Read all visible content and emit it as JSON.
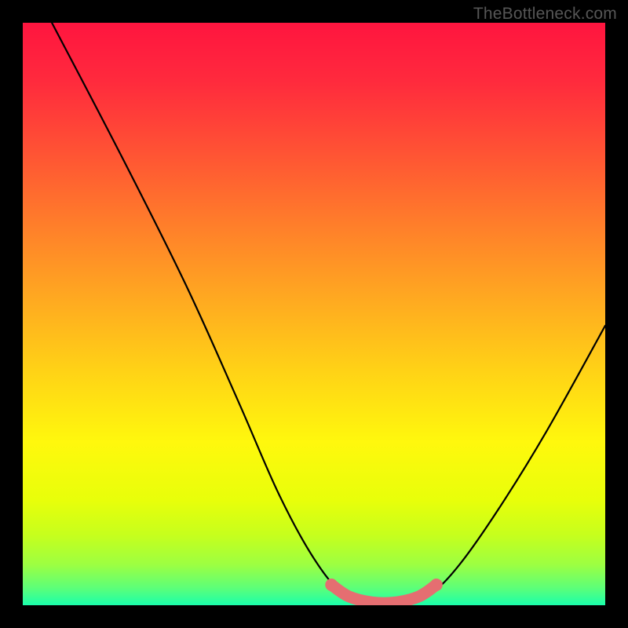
{
  "watermark": "TheBottleneck.com",
  "chart_data": {
    "type": "line",
    "title": "",
    "xlabel": "",
    "ylabel": "",
    "x_range": [
      0,
      100
    ],
    "y_range": [
      0,
      100
    ],
    "series": [
      {
        "name": "curve",
        "color": "#000000",
        "points": [
          {
            "x": 5,
            "y": 100
          },
          {
            "x": 17,
            "y": 77
          },
          {
            "x": 28,
            "y": 55
          },
          {
            "x": 37,
            "y": 35
          },
          {
            "x": 44,
            "y": 19
          },
          {
            "x": 50,
            "y": 8
          },
          {
            "x": 55,
            "y": 2
          },
          {
            "x": 60,
            "y": 0
          },
          {
            "x": 65,
            "y": 0
          },
          {
            "x": 70,
            "y": 2
          },
          {
            "x": 75,
            "y": 7
          },
          {
            "x": 82,
            "y": 17
          },
          {
            "x": 90,
            "y": 30
          },
          {
            "x": 100,
            "y": 48
          }
        ]
      },
      {
        "name": "highlight-band",
        "color": "#e56e71",
        "points": [
          {
            "x": 53,
            "y": 3.5
          },
          {
            "x": 56,
            "y": 1.5
          },
          {
            "x": 60,
            "y": 0.5
          },
          {
            "x": 64,
            "y": 0.5
          },
          {
            "x": 68,
            "y": 1.5
          },
          {
            "x": 71,
            "y": 3.5
          }
        ]
      }
    ],
    "gradient_stops": [
      {
        "pos": 0.0,
        "color": "#ff153f"
      },
      {
        "pos": 0.1,
        "color": "#ff2a3d"
      },
      {
        "pos": 0.22,
        "color": "#ff5234"
      },
      {
        "pos": 0.35,
        "color": "#ff7f2a"
      },
      {
        "pos": 0.48,
        "color": "#ffab20"
      },
      {
        "pos": 0.6,
        "color": "#ffd316"
      },
      {
        "pos": 0.72,
        "color": "#fff80d"
      },
      {
        "pos": 0.82,
        "color": "#e8ff0a"
      },
      {
        "pos": 0.88,
        "color": "#c6ff1d"
      },
      {
        "pos": 0.93,
        "color": "#9dff41"
      },
      {
        "pos": 0.97,
        "color": "#5dff78"
      },
      {
        "pos": 1.0,
        "color": "#1affab"
      }
    ]
  }
}
